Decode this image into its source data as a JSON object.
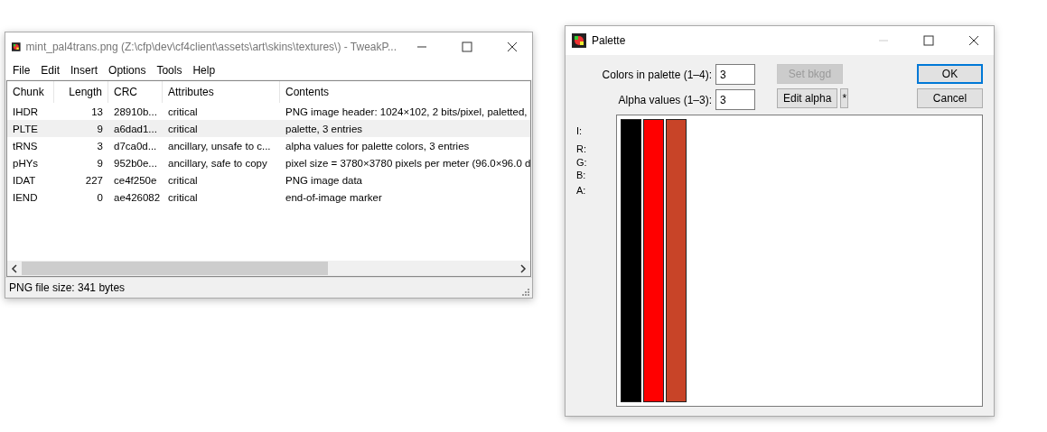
{
  "main_window": {
    "title": "mint_pal4trans.png (Z:\\cfp\\dev\\cf4client\\assets\\art\\skins\\textures\\) - TweakP...",
    "menu": [
      "File",
      "Edit",
      "Insert",
      "Options",
      "Tools",
      "Help"
    ],
    "table": {
      "columns": [
        "Chunk",
        "Length",
        "CRC",
        "Attributes",
        "Contents"
      ],
      "rows": [
        {
          "cells": [
            "IHDR",
            "13",
            "28910b...",
            "critical",
            "PNG image header: 1024×102, 2 bits/pixel, paletted,"
          ],
          "selected": false
        },
        {
          "cells": [
            "PLTE",
            "9",
            "a6dad1...",
            "critical",
            "palette, 3 entries"
          ],
          "selected": true
        },
        {
          "cells": [
            "tRNS",
            "3",
            "d7ca0d...",
            "ancillary, unsafe to c...",
            "alpha values for palette colors, 3 entries"
          ],
          "selected": false
        },
        {
          "cells": [
            "pHYs",
            "9",
            "952b0e...",
            "ancillary, safe to copy",
            "pixel size = 3780×3780 pixels per meter (96.0×96.0 d"
          ],
          "selected": false
        },
        {
          "cells": [
            "IDAT",
            "227",
            "ce4f250e",
            "critical",
            "PNG image data"
          ],
          "selected": false
        },
        {
          "cells": [
            "IEND",
            "0",
            "ae426082",
            "critical",
            "end-of-image marker"
          ],
          "selected": false
        }
      ]
    },
    "status_bar": "PNG file size: 341 bytes"
  },
  "palette_dialog": {
    "title": "Palette",
    "fields": [
      {
        "label": "Colors in palette (1–4):",
        "value": "3"
      },
      {
        "label": "Alpha values (1–3):",
        "value": "3"
      }
    ],
    "set_bkgd": {
      "label": "Set bkgd",
      "disabled": true
    },
    "edit_alpha": {
      "label": "Edit alpha",
      "disabled": false
    },
    "star_button": "*",
    "ok": "OK",
    "cancel": "Cancel",
    "channel_labels": [
      "I:",
      "R:",
      "G:",
      "B:",
      "A:"
    ],
    "swatches": [
      {
        "color": "#000000"
      },
      {
        "color": "#ff0000"
      },
      {
        "color": "#c84428"
      }
    ]
  }
}
